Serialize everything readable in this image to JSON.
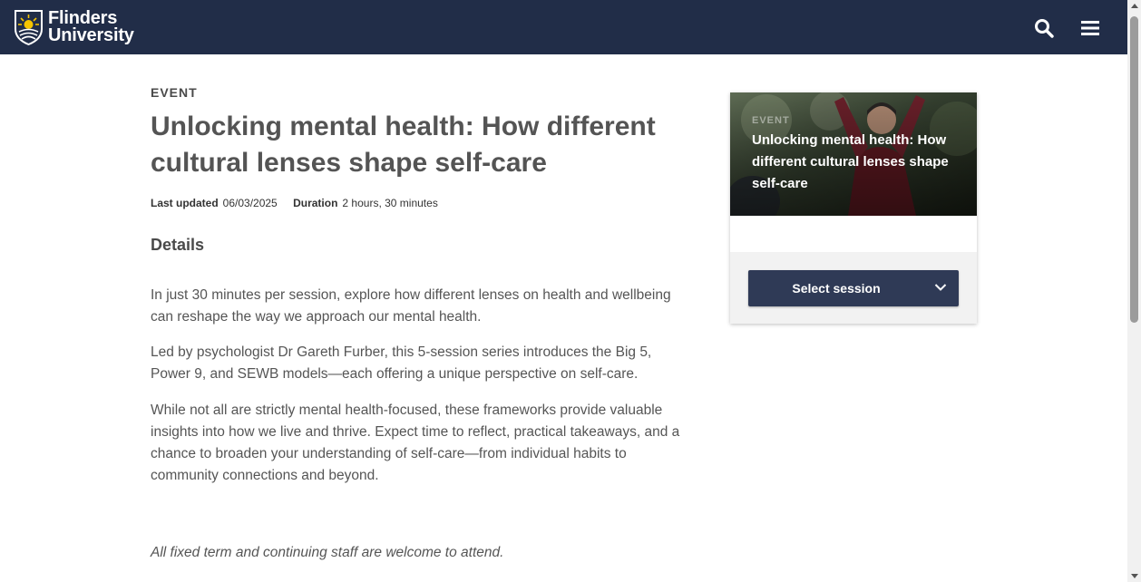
{
  "header": {
    "logo": {
      "line1": "Flinders",
      "line2": "University"
    },
    "search_icon": "search-icon",
    "menu_icon": "hamburger-menu-icon",
    "background_color": "#212d48"
  },
  "event": {
    "eyebrow": "EVENT",
    "title": "Unlocking mental health: How different cultural lenses shape self-care",
    "meta": {
      "last_updated_label": "Last updated",
      "last_updated_value": "06/03/2025",
      "duration_label": "Duration",
      "duration_value": "2 hours, 30 minutes"
    },
    "details_heading": "Details",
    "paragraphs": [
      "In just 30 minutes per session, explore how different lenses on health and wellbeing can reshape the way we approach our mental health.",
      "Led by psychologist Dr Gareth Furber, this 5-session series introduces the Big 5, Power 9, and SEWB models—each offering a unique perspective on self-care.",
      "While not all are strictly mental health-focused, these frameworks provide valuable insights into how we live and thrive. Expect time to reflect, practical takeaways, and a chance to broaden your understanding of self-care—from individual habits to community connections and beyond."
    ],
    "note": "All fixed term and continuing staff are welcome to attend."
  },
  "card": {
    "eyebrow": "EVENT",
    "title": "Unlocking mental health: How different cultural lenses shape self-care",
    "select_label": "Select session",
    "select_icon": "chevron-down-icon",
    "button_color": "#2f3a56"
  }
}
